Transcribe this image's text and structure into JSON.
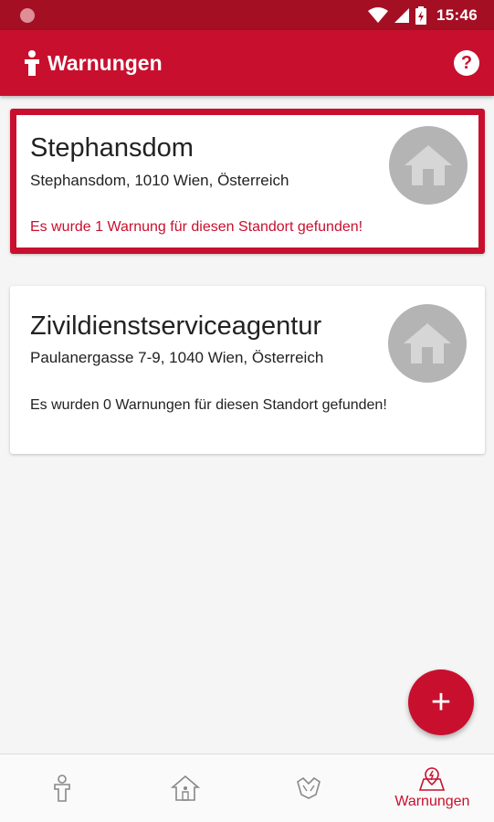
{
  "status_bar": {
    "time": "15:46"
  },
  "app_bar": {
    "title": "Warnungen",
    "help_icon": "help-icon"
  },
  "locations": [
    {
      "name": "Stephansdom",
      "address": "Stephansdom, 1010 Wien, Österreich",
      "warning": "Es wurde 1 Warnung für diesen Standort gefunden!",
      "selected": true,
      "icon": "house-icon"
    },
    {
      "name": "Zivildienstserviceagentur",
      "address": "Paulanergasse 7-9, 1040 Wien, Österreich",
      "warning": "Es wurden 0 Warnungen für diesen Standort gefunden!",
      "selected": false,
      "icon": "house-icon"
    }
  ],
  "fab": {
    "label": "+"
  },
  "bottom_nav": {
    "items": [
      {
        "icon": "person-icon",
        "label": ""
      },
      {
        "icon": "home-icon",
        "label": ""
      },
      {
        "icon": "hands-icon",
        "label": ""
      },
      {
        "icon": "warning-map-icon",
        "label": "Warnungen",
        "active": true
      }
    ]
  },
  "colors": {
    "primary": "#c8102e",
    "status_bar": "#a50f23",
    "avatar": "#b4b4b4"
  }
}
